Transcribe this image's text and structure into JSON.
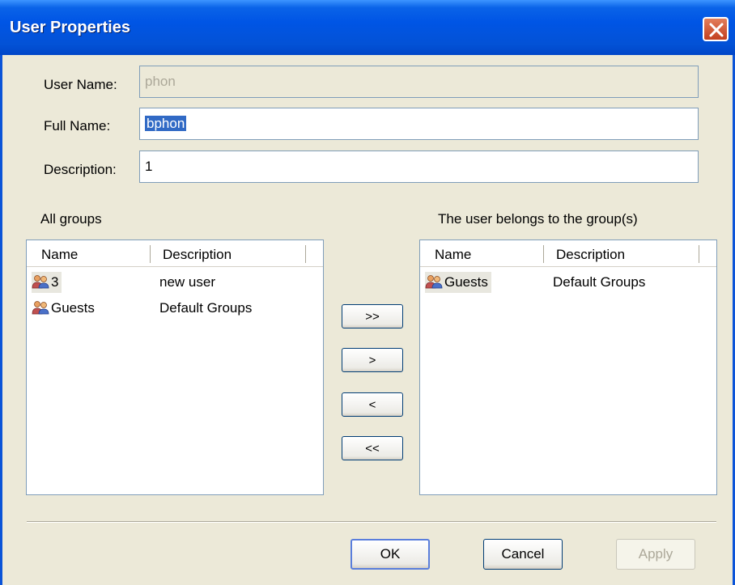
{
  "window": {
    "title": "User Properties"
  },
  "form": {
    "user_name_label": "User Name:",
    "user_name_value": "phon",
    "full_name_label": "Full Name:",
    "full_name_value": "bphon",
    "description_label": "Description:",
    "description_value": "1"
  },
  "all_groups": {
    "label": "All groups",
    "columns": [
      "Name",
      "Description"
    ],
    "rows": [
      {
        "name": "3",
        "description": "new user"
      },
      {
        "name": "Guests",
        "description": "Default Groups"
      }
    ]
  },
  "member_groups": {
    "label": "The user belongs to the group(s)",
    "columns": [
      "Name",
      "Description"
    ],
    "rows": [
      {
        "name": "Guests",
        "description": "Default Groups"
      }
    ]
  },
  "move_buttons": {
    "add_all": ">>",
    "add": ">",
    "remove": "<",
    "remove_all": "<<"
  },
  "footer": {
    "ok": "OK",
    "cancel": "Cancel",
    "apply": "Apply"
  },
  "icons": {
    "close": "close-icon",
    "group": "group-icon"
  },
  "colors": {
    "titlebar": "#0055e5",
    "dialog_bg": "#ece9d8",
    "close_button": "#c3401f",
    "selection": "#316ac5"
  }
}
